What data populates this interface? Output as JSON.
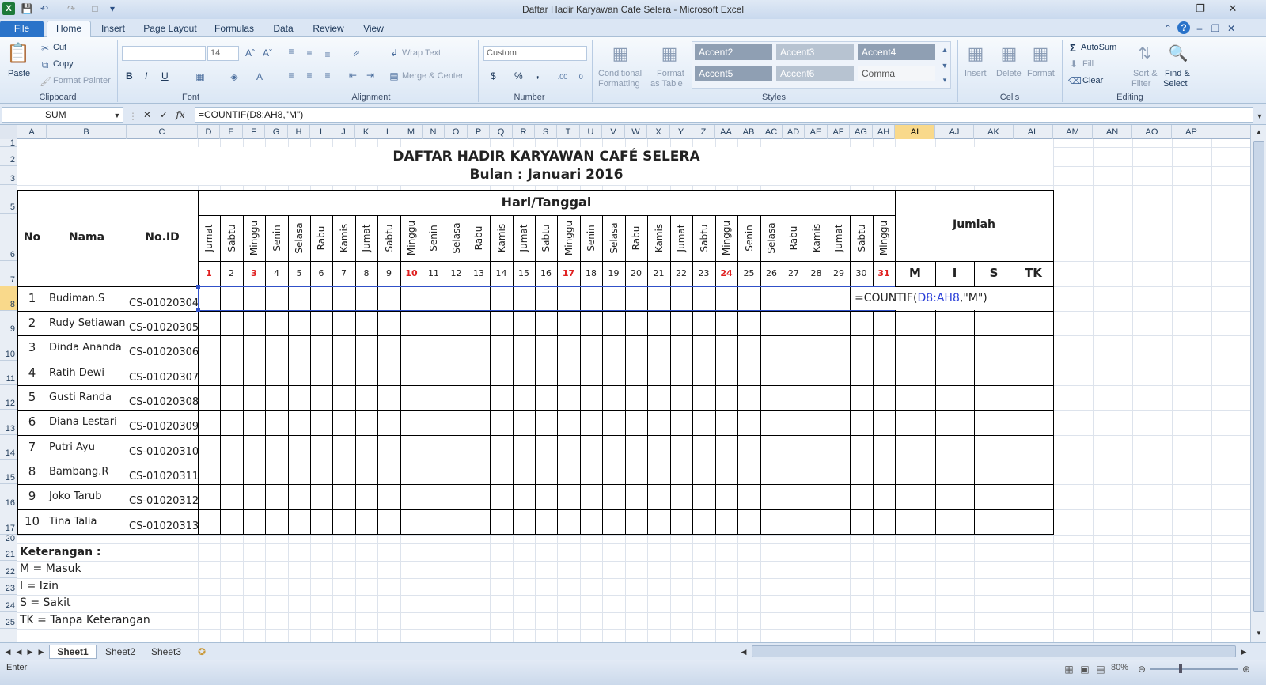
{
  "window": {
    "title": "Daftar Hadir Karyawan Cafe Selera  -  Microsoft Excel"
  },
  "tabs": [
    "File",
    "Home",
    "Insert",
    "Page Layout",
    "Formulas",
    "Data",
    "Review",
    "View"
  ],
  "ribbon": {
    "clipboard": {
      "paste": "Paste",
      "cut": "Cut",
      "copy": "Copy",
      "format_painter": "Format Painter",
      "label": "Clipboard"
    },
    "font": {
      "size": "14",
      "label": "Font",
      "bold": "B",
      "italic": "I",
      "underline": "U"
    },
    "alignment": {
      "wrap": "Wrap Text",
      "merge": "Merge & Center",
      "label": "Alignment"
    },
    "number": {
      "format": "Custom",
      "label": "Number",
      "currency": "$",
      "percent": "%",
      "comma": ","
    },
    "styles": {
      "conditional": "Conditional",
      "formatting": "Formatting",
      "format_as": "Format",
      "as_table": "as Table",
      "label": "Styles",
      "cells": [
        "Accent2",
        "Accent3",
        "Accent4",
        "Accent5",
        "Accent6",
        "Comma"
      ]
    },
    "cells": {
      "insert": "Insert",
      "delete": "Delete",
      "format": "Format",
      "label": "Cells"
    },
    "editing": {
      "autosum": "AutoSum",
      "fill": "Fill",
      "clear": "Clear",
      "sort": "Sort &",
      "filter": "Filter",
      "find": "Find &",
      "select": "Select",
      "label": "Editing"
    }
  },
  "formula_bar": {
    "name_box": "SUM",
    "fx": "fx",
    "formula": "=COUNTIF(D8:AH8,\"M\")"
  },
  "columns": [
    "A",
    "B",
    "C",
    "D",
    "E",
    "F",
    "G",
    "H",
    "I",
    "J",
    "K",
    "L",
    "M",
    "N",
    "O",
    "P",
    "Q",
    "R",
    "S",
    "T",
    "U",
    "V",
    "W",
    "X",
    "Y",
    "Z",
    "AA",
    "AB",
    "AC",
    "AD",
    "AE",
    "AF",
    "AG",
    "AH",
    "AI",
    "AJ",
    "AK",
    "AL",
    "AM",
    "AN",
    "AO",
    "AP"
  ],
  "rows": [
    "1",
    "2",
    "3",
    "5",
    "6",
    "7",
    "8",
    "9",
    "10",
    "11",
    "12",
    "13",
    "14",
    "15",
    "16",
    "17",
    "20",
    "21",
    "22",
    "23",
    "24",
    "25"
  ],
  "sheet": {
    "title": "DAFTAR HADIR KARYAWAN CAFÉ SELERA",
    "subtitle": "Bulan : Januari 2016",
    "hdr_no": "No",
    "hdr_nama": "Nama",
    "hdr_id": "No.ID",
    "hdr_hari": "Hari/Tanggal",
    "hdr_jumlah": "Jumlah",
    "days": [
      "Jumat",
      "Sabtu",
      "Minggu",
      "Senin",
      "Selasa",
      "Rabu",
      "Kamis",
      "Jumat",
      "Sabtu",
      "Minggu",
      "Senin",
      "Selasa",
      "Rabu",
      "Kamis",
      "Jumat",
      "Sabtu",
      "Minggu",
      "Senin",
      "Selasa",
      "Rabu",
      "Kamis",
      "Jumat",
      "Sabtu",
      "Minggu",
      "Senin",
      "Selasa",
      "Rabu",
      "Kamis",
      "Jumat",
      "Sabtu",
      "Minggu"
    ],
    "dates": [
      "1",
      "2",
      "3",
      "4",
      "5",
      "6",
      "7",
      "8",
      "9",
      "10",
      "11",
      "12",
      "13",
      "14",
      "15",
      "16",
      "17",
      "18",
      "19",
      "20",
      "21",
      "22",
      "23",
      "24",
      "25",
      "26",
      "27",
      "28",
      "29",
      "30",
      "31"
    ],
    "red_dates": [
      "1",
      "3",
      "10",
      "17",
      "24",
      "31"
    ],
    "sum_cols": [
      "M",
      "I",
      "S",
      "TK"
    ],
    "employees": [
      {
        "no": "1",
        "nama": "Budiman.S",
        "id": "CS-01020304"
      },
      {
        "no": "2",
        "nama": "Rudy Setiawan",
        "id": "CS-01020305"
      },
      {
        "no": "3",
        "nama": "Dinda Ananda",
        "id": "CS-01020306"
      },
      {
        "no": "4",
        "nama": "Ratih Dewi",
        "id": "CS-01020307"
      },
      {
        "no": "5",
        "nama": "Gusti Randa",
        "id": "CS-01020308"
      },
      {
        "no": "6",
        "nama": "Diana Lestari",
        "id": "CS-01020309"
      },
      {
        "no": "7",
        "nama": "Putri Ayu",
        "id": "CS-01020310"
      },
      {
        "no": "8",
        "nama": "Bambang.R",
        "id": "CS-01020311"
      },
      {
        "no": "9",
        "nama": "Joko Tarub",
        "id": "CS-01020312"
      },
      {
        "no": "10",
        "nama": "Tina Talia",
        "id": "CS-01020313"
      }
    ],
    "edit_formula": {
      "prefix": "=COUNTIF(",
      "range": "D8:AH8",
      "suffix": ",\"M\")"
    },
    "legend": [
      "Keterangan :",
      "M = Masuk",
      "I = Izin",
      "S = Sakit",
      "TK = Tanpa Keterangan"
    ]
  },
  "sheet_tabs": [
    "Sheet1",
    "Sheet2",
    "Sheet3"
  ],
  "status": {
    "mode": "Enter",
    "zoom": "80%"
  }
}
